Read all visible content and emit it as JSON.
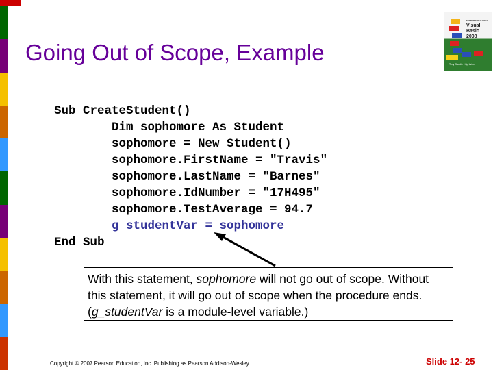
{
  "title": "Going Out of Scope, Example",
  "cover": {
    "series": "STARTING OUT WITH",
    "title": "Visual Basic 2008",
    "authors": "Tony Gaddis · Kip Irvine"
  },
  "colors": {
    "stripes": [
      "#006600",
      "#770077",
      "#f5c000",
      "#cc6600",
      "#3399ff",
      "#006600",
      "#770077",
      "#f5c000",
      "#cc6600",
      "#3399ff",
      "#cc3300"
    ],
    "top_bar": "#cc0000",
    "title": "#660099",
    "code_highlight": "#333399",
    "slide_number": "#cc0000"
  },
  "code": {
    "lines": [
      "Sub CreateStudent()",
      "        Dim sophomore As Student",
      "        sophomore = New Student()",
      "        sophomore.FirstName = \"Travis\"",
      "        sophomore.LastName = \"Barnes\"",
      "        sophomore.IdNumber = \"17H495\"",
      "        sophomore.TestAverage = 94.7"
    ],
    "highlight": "        g_studentVar = sophomore",
    "end": "End Sub"
  },
  "callout": {
    "p1": "With this statement, ",
    "i1": "sophomore",
    "p2": " will not go out of scope. Without this statement, it will go out of scope when the procedure ends.  (",
    "i2": "g_studentVar",
    "p3": " is a module-level variable.)"
  },
  "footer": {
    "copyright": "Copyright © 2007 Pearson Education, Inc. Publishing as Pearson Addison-Wesley",
    "slide": "Slide 12- 25"
  }
}
